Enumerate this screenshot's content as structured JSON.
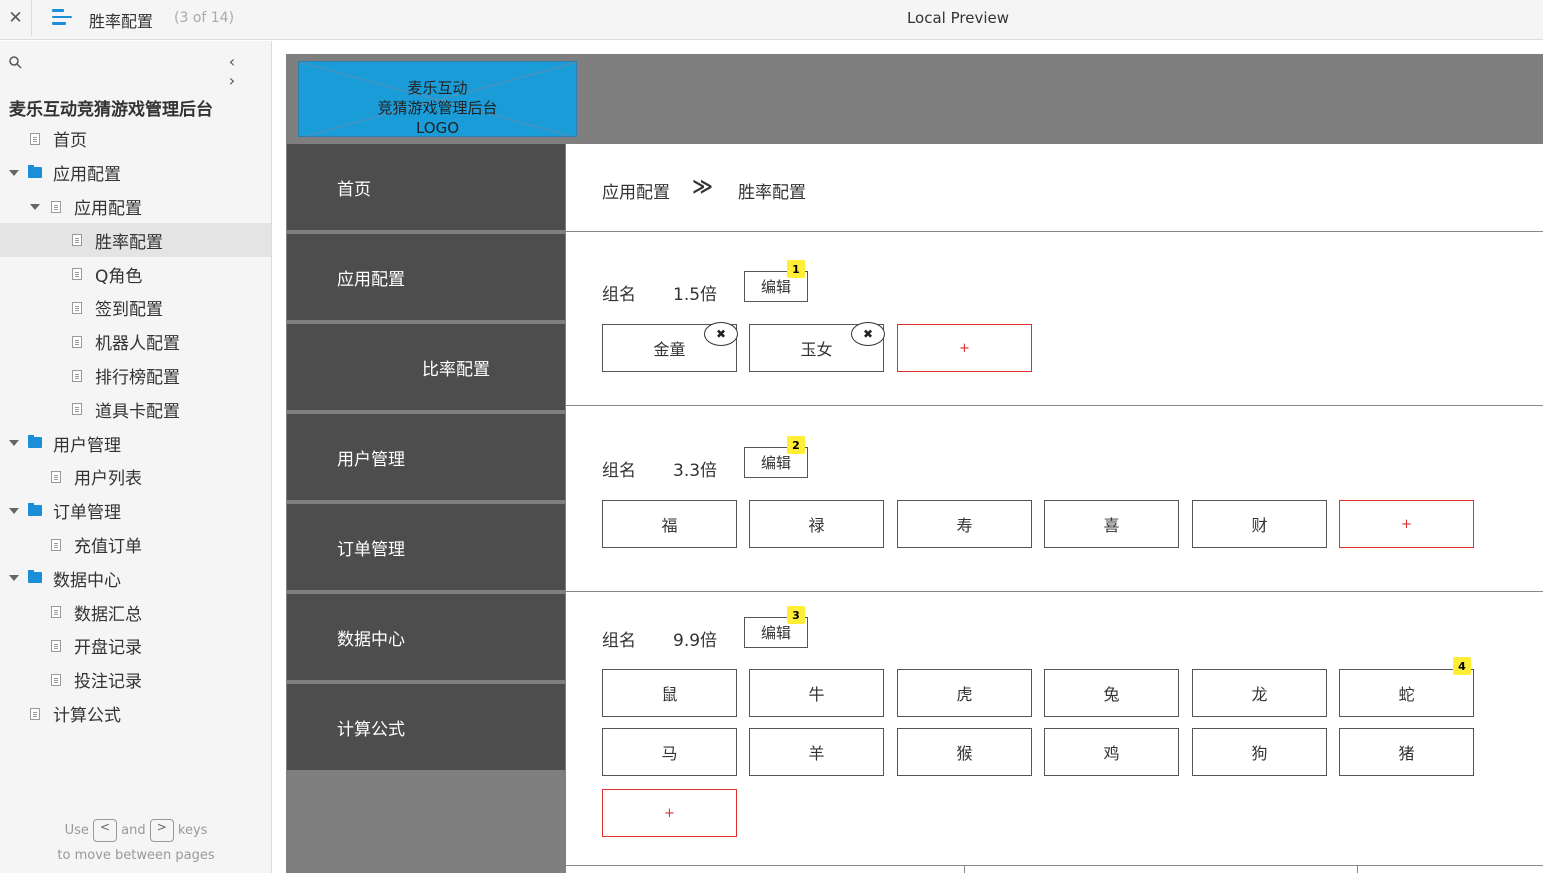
{
  "topbar": {
    "close": "✕",
    "page_name": "胜率配置",
    "page_count": "(3 of 14)",
    "preview_title": "Local Preview"
  },
  "sidebar": {
    "project_title": "麦乐互动竞猜游戏管理后台",
    "items": [
      {
        "label": "首页",
        "type": "page",
        "level": 0
      },
      {
        "label": "应用配置",
        "type": "folder",
        "level": 0
      },
      {
        "label": "应用配置",
        "type": "page-parent",
        "level": 1
      },
      {
        "label": "胜率配置",
        "type": "page",
        "level": 2,
        "active": true
      },
      {
        "label": "Q角色",
        "type": "page",
        "level": 2
      },
      {
        "label": "签到配置",
        "type": "page",
        "level": 2
      },
      {
        "label": "机器人配置",
        "type": "page",
        "level": 2
      },
      {
        "label": "排行榜配置",
        "type": "page",
        "level": 2
      },
      {
        "label": "道具卡配置",
        "type": "page",
        "level": 2
      },
      {
        "label": "用户管理",
        "type": "folder",
        "level": 0
      },
      {
        "label": "用户列表",
        "type": "page",
        "level": 1
      },
      {
        "label": "订单管理",
        "type": "folder",
        "level": 0
      },
      {
        "label": "充值订单",
        "type": "page",
        "level": 1
      },
      {
        "label": "数据中心",
        "type": "folder",
        "level": 0
      },
      {
        "label": "数据汇总",
        "type": "page",
        "level": 1
      },
      {
        "label": "开盘记录",
        "type": "page",
        "level": 1
      },
      {
        "label": "投注记录",
        "type": "page",
        "level": 1
      },
      {
        "label": "计算公式",
        "type": "page",
        "level": 0
      }
    ],
    "hint": {
      "use": "Use",
      "and": "and",
      "keys": "keys",
      "line2": "to move between pages",
      "key_prev": "<",
      "key_next": ">"
    }
  },
  "proto": {
    "logo_lines": [
      "麦乐互动",
      "竞猜游戏管理后台",
      "LOGO"
    ],
    "menu": [
      "首页",
      "应用配置",
      "比率配置",
      "用户管理",
      "订单管理",
      "数据中心",
      "计算公式"
    ],
    "breadcrumb": {
      "parent": "应用配置",
      "sep": "≫",
      "current": "胜率配置"
    },
    "groups": [
      {
        "label": "组名",
        "rate": "1.5倍",
        "edit": "编辑",
        "badge": "1",
        "tiles": [
          "金童",
          "玉女"
        ],
        "add": "+"
      },
      {
        "label": "组名",
        "rate": "3.3倍",
        "edit": "编辑",
        "badge": "2",
        "tiles": [
          "福",
          "禄",
          "寿",
          "喜",
          "财"
        ],
        "add": "+"
      },
      {
        "label": "组名",
        "rate": "9.9倍",
        "edit": "编辑",
        "badge": "3",
        "tiles": [
          "鼠",
          "牛",
          "虎",
          "兔",
          "龙",
          "蛇",
          "马",
          "羊",
          "猴",
          "鸡",
          "狗",
          "猪"
        ],
        "add": "+",
        "tile_badge": "4"
      }
    ],
    "remove_icon": "✖"
  },
  "colors": {
    "accent": "#1a8fd8",
    "logo_bg": "#1a9cd8",
    "menu_bg": "#4d4d4d",
    "band_bg": "#7f7f7f",
    "add_border": "#e03030",
    "badge": "#ffee33"
  }
}
